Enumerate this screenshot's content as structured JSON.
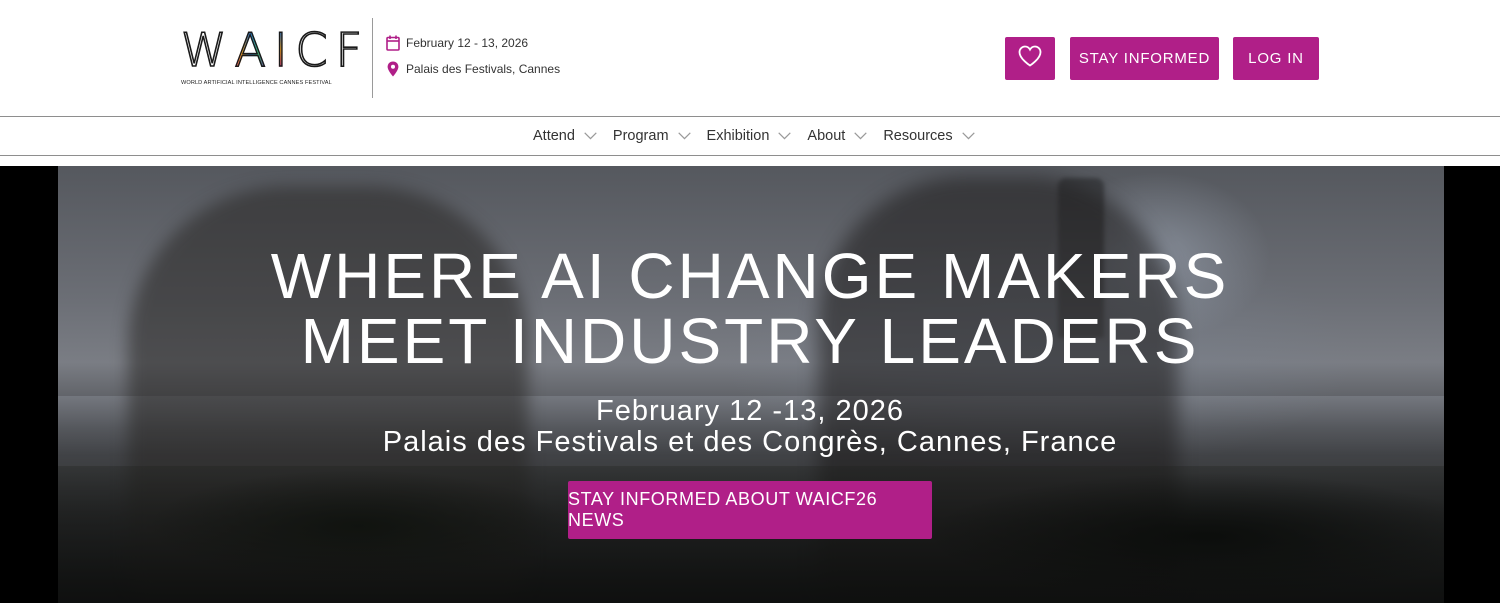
{
  "brand": {
    "logo_letters": [
      "W",
      "A",
      "I",
      "C",
      "F"
    ],
    "tagline": "WORLD ARTIFICIAL INTELLIGENCE CANNES FESTIVAL",
    "accent_color": "#b01f88"
  },
  "event_info": {
    "date": "February 12 - 13, 2026",
    "date_icon": "calendar-icon",
    "location": "Palais des Festivals, Cannes",
    "location_icon": "map-pin-icon"
  },
  "header_actions": {
    "favorite_icon": "heart-icon",
    "stay_informed_label": "STAY INFORMED",
    "login_label": "LOG IN"
  },
  "nav": {
    "items": [
      {
        "label": "Attend",
        "icon": "chevron-down-icon"
      },
      {
        "label": "Program",
        "icon": "chevron-down-icon"
      },
      {
        "label": "Exhibition",
        "icon": "chevron-down-icon"
      },
      {
        "label": "About",
        "icon": "chevron-down-icon"
      },
      {
        "label": "Resources",
        "icon": "chevron-down-icon"
      }
    ]
  },
  "hero": {
    "title_line1": "WHERE AI CHANGE MAKERS",
    "title_line2": "MEET INDUSTRY LEADERS",
    "date": "February 12 -13, 2026",
    "venue": "Palais des Festivals et des Congrès, Cannes, France",
    "cta_label": "STAY INFORMED ABOUT WAICF26 NEWS"
  }
}
